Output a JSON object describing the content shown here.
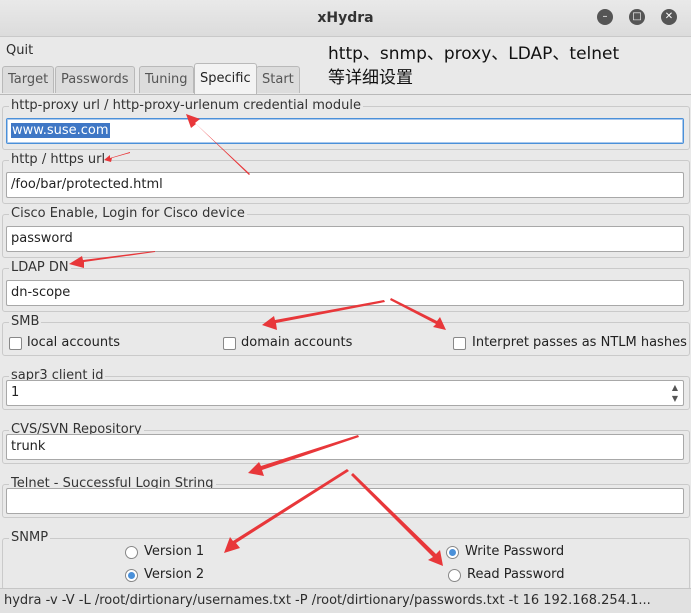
{
  "window": {
    "title": "xHydra"
  },
  "menubar": {
    "quit": "Quit"
  },
  "tabs": [
    "Target",
    "Passwords",
    "Tuning",
    "Specific",
    "Start"
  ],
  "active_tab": "Specific",
  "annotation": {
    "line1": "http、snmp、proxy、LDAP、telnet",
    "line2": "等详细设置"
  },
  "groups": {
    "proxy": {
      "label": "http-proxy url / http-proxy-urlenum credential module",
      "value": "www.suse.com"
    },
    "http": {
      "label": "http / https url",
      "value": "/foo/bar/protected.html"
    },
    "cisco": {
      "label": "Cisco Enable, Login for Cisco device",
      "value": "password"
    },
    "ldap": {
      "label": "LDAP DN",
      "value": "dn-scope"
    },
    "smb": {
      "label": "SMB",
      "local": "local accounts",
      "domain": "domain accounts",
      "ntlm": "Interpret passes as NTLM hashes"
    },
    "sapr3": {
      "label": "sapr3 client id",
      "value": "1"
    },
    "cvs": {
      "label": "CVS/SVN Repository",
      "value": "trunk"
    },
    "telnet": {
      "label": "Telnet - Successful Login String",
      "value": ""
    },
    "snmp": {
      "label": "SNMP",
      "v1": "Version 1",
      "v2": "Version 2",
      "write": "Write Password",
      "read": "Read Password"
    }
  },
  "status": {
    "command": "hydra -v -V -L /root/dirtionary/usernames.txt -P /root/dirtionary/passwords.txt -t 16 192.168.254.1..."
  },
  "colors": {
    "annotation_arrow": "#e8373a",
    "selection": "#3f77c5"
  }
}
